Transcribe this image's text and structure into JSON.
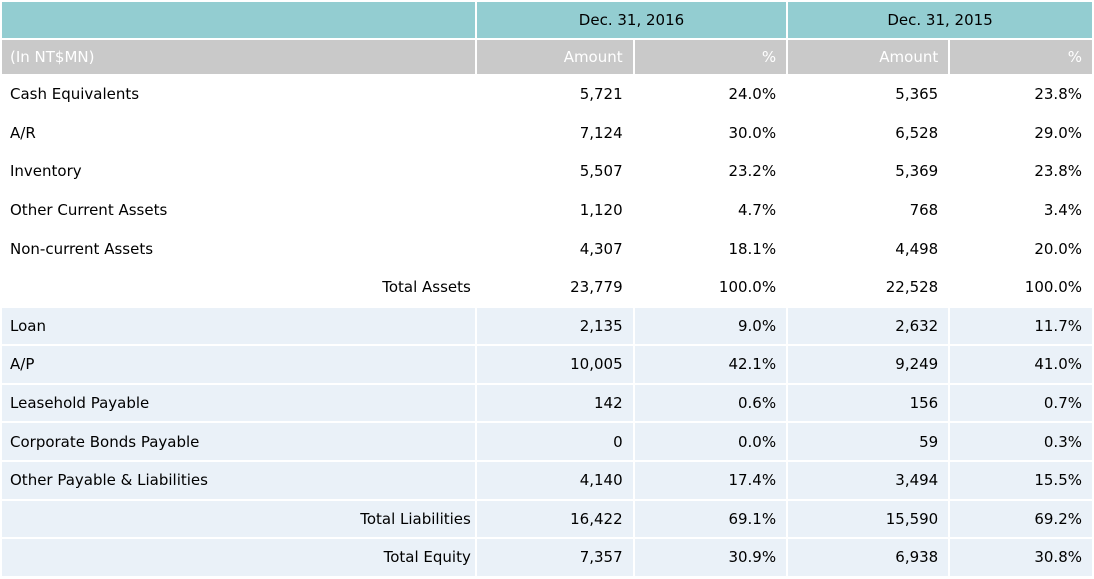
{
  "colors": {
    "header_teal": "#93cdd1",
    "subheader_gray": "#c9c9c9",
    "highlight_row_blue": "#eaf1f8",
    "separator_white": "#ffffff",
    "text_black": "#000000",
    "subheader_text_white": "#ffffff"
  },
  "table": {
    "unit_label": "(In NT$MN)",
    "col_groups": [
      {
        "label": "Dec. 31, 2016"
      },
      {
        "label": "Dec. 31, 2015"
      }
    ],
    "sub_headers": [
      "Amount",
      "%",
      "Amount",
      "%"
    ],
    "rows": [
      {
        "label": "Cash Equivalents",
        "section": "assets",
        "is_total": false,
        "values": [
          "5,721",
          "24.0%",
          "5,365",
          "23.8%"
        ]
      },
      {
        "label": "A/R",
        "section": "assets",
        "is_total": false,
        "values": [
          "7,124",
          "30.0%",
          "6,528",
          "29.0%"
        ]
      },
      {
        "label": "Inventory",
        "section": "assets",
        "is_total": false,
        "values": [
          "5,507",
          "23.2%",
          "5,369",
          "23.8%"
        ]
      },
      {
        "label": "Other Current Assets",
        "section": "assets",
        "is_total": false,
        "values": [
          "1,120",
          "4.7%",
          "768",
          "3.4%"
        ]
      },
      {
        "label": "Non-current Assets",
        "section": "assets",
        "is_total": false,
        "values": [
          "4,307",
          "18.1%",
          "4,498",
          "20.0%"
        ]
      },
      {
        "label": "Total Assets",
        "section": "assets",
        "is_total": true,
        "values": [
          "23,779",
          "100.0%",
          "22,528",
          "100.0%"
        ]
      },
      {
        "label": "Loan",
        "section": "liabilities",
        "is_total": false,
        "values": [
          "2,135",
          "9.0%",
          "2,632",
          "11.7%"
        ]
      },
      {
        "label": "A/P",
        "section": "liabilities",
        "is_total": false,
        "values": [
          "10,005",
          "42.1%",
          "9,249",
          "41.0%"
        ]
      },
      {
        "label": "Leasehold Payable",
        "section": "liabilities",
        "is_total": false,
        "values": [
          "142",
          "0.6%",
          "156",
          "0.7%"
        ]
      },
      {
        "label": "Corporate Bonds Payable",
        "section": "liabilities",
        "is_total": false,
        "values": [
          "0",
          "0.0%",
          "59",
          "0.3%"
        ]
      },
      {
        "label": "Other Payable & Liabilities",
        "section": "liabilities",
        "is_total": false,
        "values": [
          "4,140",
          "17.4%",
          "3,494",
          "15.5%"
        ]
      },
      {
        "label": "Total Liabilities",
        "section": "liabilities",
        "is_total": true,
        "values": [
          "16,422",
          "69.1%",
          "15,590",
          "69.2%"
        ]
      },
      {
        "label": "Total Equity",
        "section": "equity",
        "is_total": true,
        "values": [
          "7,357",
          "30.9%",
          "6,938",
          "30.8%"
        ]
      }
    ]
  }
}
